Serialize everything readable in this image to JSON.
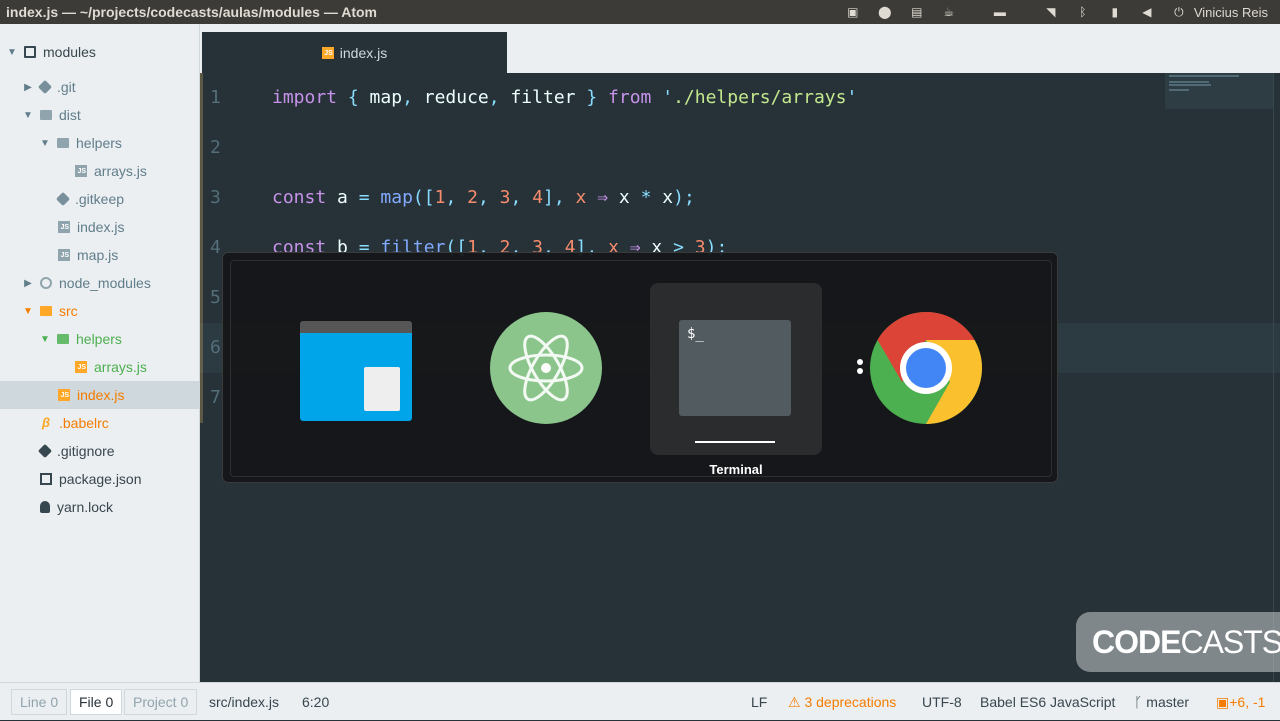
{
  "window": {
    "title": "index.js — ~/projects/codecasts/aulas/modules — Atom"
  },
  "tray": {
    "user": "Vinicius Reis"
  },
  "tree": {
    "root": "modules",
    "items": [
      {
        "label": ".git"
      },
      {
        "label": "dist"
      },
      {
        "label": "helpers"
      },
      {
        "label": "arrays.js"
      },
      {
        "label": ".gitkeep"
      },
      {
        "label": "index.js"
      },
      {
        "label": "map.js"
      },
      {
        "label": "node_modules"
      },
      {
        "label": "src"
      },
      {
        "label": "helpers"
      },
      {
        "label": "arrays.js"
      },
      {
        "label": "index.js"
      },
      {
        "label": ".babelrc"
      },
      {
        "label": ".gitignore"
      },
      {
        "label": "package.json"
      },
      {
        "label": "yarn.lock"
      }
    ]
  },
  "tab": {
    "label": "index.js",
    "badge": "JS"
  },
  "editor": {
    "line_numbers": [
      "1",
      "2",
      "3",
      "4",
      "5",
      "6",
      "7"
    ],
    "lines": [
      [
        {
          "t": "import",
          "c": "kw"
        },
        {
          "t": " { ",
          "c": "punc"
        },
        {
          "t": "map",
          "c": "var"
        },
        {
          "t": ", ",
          "c": "punc"
        },
        {
          "t": "reduce",
          "c": "var"
        },
        {
          "t": ", ",
          "c": "punc"
        },
        {
          "t": "filter",
          "c": "var"
        },
        {
          "t": " } ",
          "c": "punc"
        },
        {
          "t": "from",
          "c": "kw"
        },
        {
          "t": " '",
          "c": "punc"
        },
        {
          "t": "./helpers/arrays",
          "c": "str"
        },
        {
          "t": "'",
          "c": "punc"
        }
      ],
      [],
      [
        {
          "t": "const",
          "c": "kw"
        },
        {
          "t": " a ",
          "c": "var"
        },
        {
          "t": "=",
          "c": "op"
        },
        {
          "t": " ",
          "c": "var"
        },
        {
          "t": "map",
          "c": "fn"
        },
        {
          "t": "([",
          "c": "punc"
        },
        {
          "t": "1",
          "c": "num"
        },
        {
          "t": ", ",
          "c": "punc"
        },
        {
          "t": "2",
          "c": "num"
        },
        {
          "t": ", ",
          "c": "punc"
        },
        {
          "t": "3",
          "c": "num"
        },
        {
          "t": ", ",
          "c": "punc"
        },
        {
          "t": "4",
          "c": "num"
        },
        {
          "t": "], ",
          "c": "punc"
        },
        {
          "t": "x",
          "c": "num"
        },
        {
          "t": " ⇒ ",
          "c": "kw"
        },
        {
          "t": "x ",
          "c": "var"
        },
        {
          "t": "*",
          "c": "op"
        },
        {
          "t": " x",
          "c": "var"
        },
        {
          "t": ");",
          "c": "punc"
        }
      ],
      [
        {
          "t": "const",
          "c": "kw"
        },
        {
          "t": " b ",
          "c": "var"
        },
        {
          "t": "=",
          "c": "op"
        },
        {
          "t": " ",
          "c": "var"
        },
        {
          "t": "filter",
          "c": "fn"
        },
        {
          "t": "([",
          "c": "punc"
        },
        {
          "t": "1",
          "c": "num"
        },
        {
          "t": ", ",
          "c": "punc"
        },
        {
          "t": "2",
          "c": "num"
        },
        {
          "t": ", ",
          "c": "punc"
        },
        {
          "t": "3",
          "c": "num"
        },
        {
          "t": ", ",
          "c": "punc"
        },
        {
          "t": "4",
          "c": "num"
        },
        {
          "t": "], ",
          "c": "punc"
        },
        {
          "t": "x",
          "c": "num"
        },
        {
          "t": " ⇒ ",
          "c": "kw"
        },
        {
          "t": "x ",
          "c": "var"
        },
        {
          "t": ">",
          "c": "op"
        },
        {
          "t": " ",
          "c": "var"
        },
        {
          "t": "3",
          "c": "num"
        },
        {
          "t": ");",
          "c": "punc"
        }
      ],
      [],
      [],
      []
    ]
  },
  "switcher": {
    "apps": [
      {
        "name": "files",
        "icon": "files-icon"
      },
      {
        "name": "atom",
        "icon": "atom-icon"
      },
      {
        "name": "Terminal",
        "icon": "terminal-icon",
        "prompt": "$_"
      },
      {
        "name": "chrome",
        "icon": "chrome-icon"
      }
    ],
    "selected_label": "Terminal"
  },
  "watermark": {
    "bold": "CODE",
    "light": "CASTS"
  },
  "status": {
    "line": {
      "label": "Line",
      "count": "0"
    },
    "file": {
      "label": "File",
      "count": "0"
    },
    "project": {
      "label": "Project",
      "count": "0"
    },
    "path": "src/index.js",
    "cursor": "6:20",
    "eol": "LF",
    "deprecations": "3 deprecations",
    "encoding": "UTF-8",
    "grammar": "Babel ES6 JavaScript",
    "branch": "master",
    "diff": "+6, -1"
  },
  "colors": {
    "editor_bg": "#263238",
    "sidebar_bg": "#eceff1",
    "accent": "#ffa726",
    "green": "#4caf50"
  }
}
